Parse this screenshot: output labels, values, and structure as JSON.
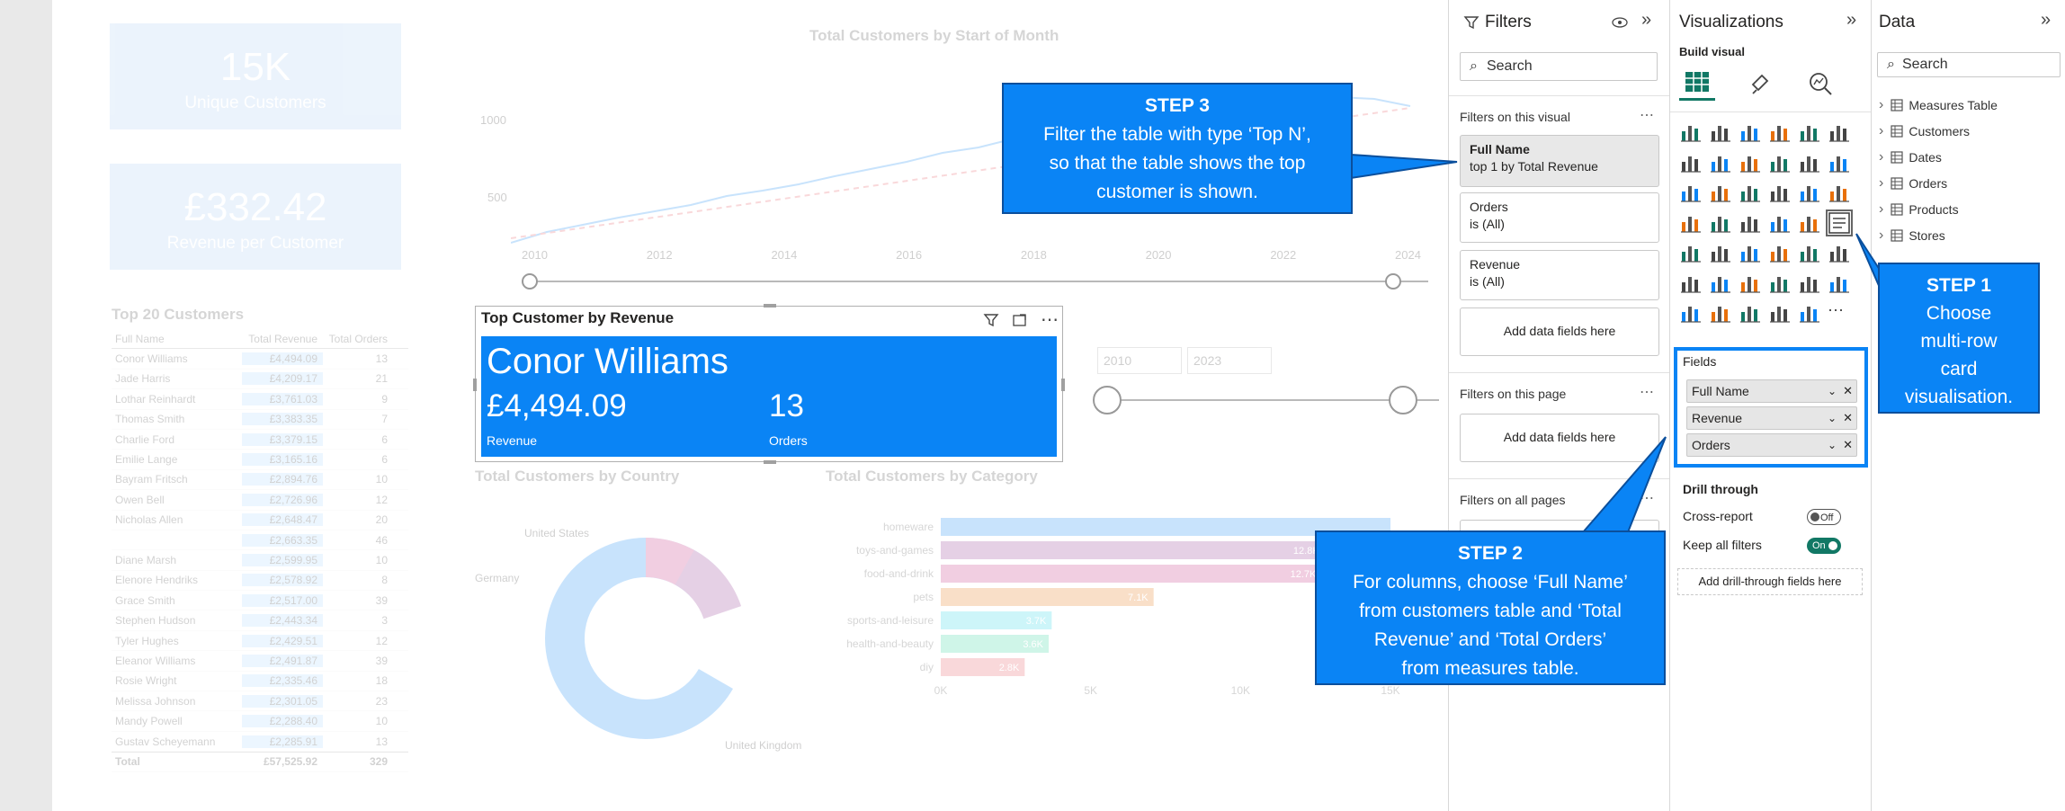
{
  "canvas": {
    "kpi1": {
      "value": "15K",
      "label": "Unique Customers"
    },
    "kpi2": {
      "value": "£332.42",
      "label": "Revenue per Customer"
    },
    "line_chart": {
      "title": "Total Customers by Start of Month",
      "y_ticks": [
        "1000",
        "500"
      ],
      "x_ticks": [
        "2010",
        "2012",
        "2014",
        "2016",
        "2018",
        "2020",
        "2022",
        "2024"
      ]
    },
    "date_slicer": {
      "from": "2010",
      "to": "2023"
    },
    "top20": {
      "title": "Top 20 Customers",
      "headers": [
        "Full Name",
        "Total Revenue",
        "Total Orders"
      ],
      "rows": [
        [
          "Conor Williams",
          "£4,494.09",
          "13"
        ],
        [
          "Jade Harris",
          "£4,209.17",
          "21"
        ],
        [
          "Lothar Reinhardt",
          "£3,761.03",
          "9"
        ],
        [
          "Thomas Smith",
          "£3,383.35",
          "7"
        ],
        [
          "Charlie Ford",
          "£3,379.15",
          "6"
        ],
        [
          "Emilie Lange",
          "£3,165.16",
          "6"
        ],
        [
          "Bayram Fritsch",
          "£2,894.76",
          "10"
        ],
        [
          "Owen Bell",
          "£2,726.96",
          "12"
        ],
        [
          "Nicholas Allen",
          "£2,648.47",
          "20"
        ],
        [
          "",
          "£2,663.35",
          "46"
        ],
        [
          "Diane Marsh",
          "£2,599.95",
          "10"
        ],
        [
          "Elenore Hendriks",
          "£2,578.92",
          "8"
        ],
        [
          "Grace Smith",
          "£2,517.00",
          "39"
        ],
        [
          "Stephen Hudson",
          "£2,443.34",
          "3"
        ],
        [
          "Tyler Hughes",
          "£2,429.51",
          "12"
        ],
        [
          "Eleanor Williams",
          "£2,491.87",
          "39"
        ],
        [
          "Rosie Wright",
          "£2,335.46",
          "18"
        ],
        [
          "Melissa Johnson",
          "£2,301.05",
          "23"
        ],
        [
          "Mandy Powell",
          "£2,288.40",
          "10"
        ],
        [
          "Gustav Scheyemann",
          "£2,285.91",
          "13"
        ]
      ],
      "total": [
        "Total",
        "£57,525.92",
        "329"
      ]
    },
    "donut": {
      "title": "Total Customers by Country",
      "labels": [
        "United States",
        "Germany",
        "United Kingdom"
      ],
      "slices": [
        0.08,
        0.12,
        0.8
      ]
    },
    "category_chart": {
      "title": "Total Customers by Category",
      "categories": [
        "homeware",
        "toys-and-games",
        "food-and-drink",
        "pets",
        "sports-and-leisure",
        "health-and-beauty",
        "diy"
      ],
      "bar_labels": [
        "",
        "12.8K",
        "12.7K",
        "7.1K",
        "3.7K",
        "3.6K",
        "2.8K"
      ],
      "values": [
        15,
        12.8,
        12.7,
        7.1,
        3.7,
        3.6,
        2.8
      ],
      "x_ticks": [
        "0K",
        "5K",
        "10K",
        "15K"
      ],
      "colors": [
        "#0a84f5",
        "#8e2e8e",
        "#c2247a",
        "#e8700a",
        "#1fd3e8",
        "#2ad39a",
        "#e6505a"
      ]
    },
    "top_card": {
      "title": "Top Customer by Revenue",
      "name": "Conor Williams",
      "revenue": "£4,494.09",
      "revenue_label": "Revenue",
      "orders": "13",
      "orders_label": "Orders"
    }
  },
  "filters": {
    "title": "Filters",
    "search_placeholder": "Search",
    "on_visual_label": "Filters on this visual",
    "visual_filters": [
      {
        "name": "Full Name",
        "desc": "top 1 by Total Revenue"
      },
      {
        "name": "Orders",
        "desc": "is (All)"
      },
      {
        "name": "Revenue",
        "desc": "is (All)"
      }
    ],
    "add_fields": "Add data fields here",
    "on_page_label": "Filters on this page",
    "on_all_pages_label": "Filters on all pages"
  },
  "visualizations": {
    "title": "Visualizations",
    "build_visual": "Build visual",
    "fields_label": "Fields",
    "fields": [
      "Full Name",
      "Revenue",
      "Orders"
    ],
    "drill_through": "Drill through",
    "cross_report": "Cross-report",
    "cross_report_state": "Off",
    "keep_all_filters": "Keep all filters",
    "keep_all_filters_state": "On",
    "add_drill": "Add drill-through fields here",
    "accent": "#0a84f5"
  },
  "data": {
    "title": "Data",
    "search_placeholder": "Search",
    "tables": [
      "Measures Table",
      "Customers",
      "Dates",
      "Orders",
      "Products",
      "Stores"
    ]
  },
  "callouts": {
    "step1": {
      "title": "STEP 1",
      "lines": [
        "Choose",
        "multi-row",
        "card",
        "visualisation."
      ]
    },
    "step2": {
      "title": "STEP 2",
      "lines": [
        "For columns, choose ‘Full Name’",
        "from customers table and ‘Total",
        "Revenue’ and ‘Total Orders’",
        "from measures table."
      ]
    },
    "step3": {
      "title": "STEP 3",
      "lines": [
        "Filter the table with type ‘Top N’,",
        "so that the table shows the  top",
        "customer is shown."
      ]
    }
  }
}
